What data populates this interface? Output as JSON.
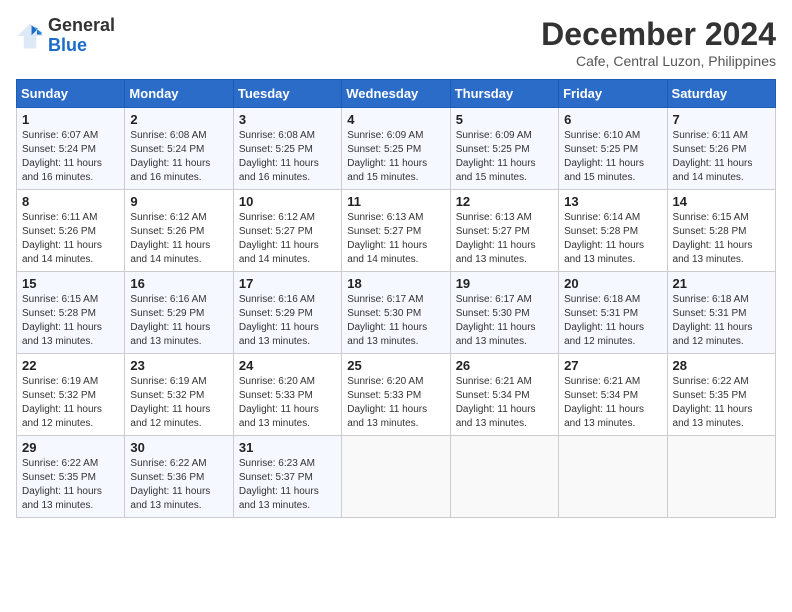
{
  "logo": {
    "general": "General",
    "blue": "Blue"
  },
  "title": "December 2024",
  "location": "Cafe, Central Luzon, Philippines",
  "days_header": [
    "Sunday",
    "Monday",
    "Tuesday",
    "Wednesday",
    "Thursday",
    "Friday",
    "Saturday"
  ],
  "weeks": [
    [
      {
        "day": "1",
        "sunrise": "Sunrise: 6:07 AM",
        "sunset": "Sunset: 5:24 PM",
        "daylight": "Daylight: 11 hours and 16 minutes."
      },
      {
        "day": "2",
        "sunrise": "Sunrise: 6:08 AM",
        "sunset": "Sunset: 5:24 PM",
        "daylight": "Daylight: 11 hours and 16 minutes."
      },
      {
        "day": "3",
        "sunrise": "Sunrise: 6:08 AM",
        "sunset": "Sunset: 5:25 PM",
        "daylight": "Daylight: 11 hours and 16 minutes."
      },
      {
        "day": "4",
        "sunrise": "Sunrise: 6:09 AM",
        "sunset": "Sunset: 5:25 PM",
        "daylight": "Daylight: 11 hours and 15 minutes."
      },
      {
        "day": "5",
        "sunrise": "Sunrise: 6:09 AM",
        "sunset": "Sunset: 5:25 PM",
        "daylight": "Daylight: 11 hours and 15 minutes."
      },
      {
        "day": "6",
        "sunrise": "Sunrise: 6:10 AM",
        "sunset": "Sunset: 5:25 PM",
        "daylight": "Daylight: 11 hours and 15 minutes."
      },
      {
        "day": "7",
        "sunrise": "Sunrise: 6:11 AM",
        "sunset": "Sunset: 5:26 PM",
        "daylight": "Daylight: 11 hours and 14 minutes."
      }
    ],
    [
      {
        "day": "8",
        "sunrise": "Sunrise: 6:11 AM",
        "sunset": "Sunset: 5:26 PM",
        "daylight": "Daylight: 11 hours and 14 minutes."
      },
      {
        "day": "9",
        "sunrise": "Sunrise: 6:12 AM",
        "sunset": "Sunset: 5:26 PM",
        "daylight": "Daylight: 11 hours and 14 minutes."
      },
      {
        "day": "10",
        "sunrise": "Sunrise: 6:12 AM",
        "sunset": "Sunset: 5:27 PM",
        "daylight": "Daylight: 11 hours and 14 minutes."
      },
      {
        "day": "11",
        "sunrise": "Sunrise: 6:13 AM",
        "sunset": "Sunset: 5:27 PM",
        "daylight": "Daylight: 11 hours and 14 minutes."
      },
      {
        "day": "12",
        "sunrise": "Sunrise: 6:13 AM",
        "sunset": "Sunset: 5:27 PM",
        "daylight": "Daylight: 11 hours and 13 minutes."
      },
      {
        "day": "13",
        "sunrise": "Sunrise: 6:14 AM",
        "sunset": "Sunset: 5:28 PM",
        "daylight": "Daylight: 11 hours and 13 minutes."
      },
      {
        "day": "14",
        "sunrise": "Sunrise: 6:15 AM",
        "sunset": "Sunset: 5:28 PM",
        "daylight": "Daylight: 11 hours and 13 minutes."
      }
    ],
    [
      {
        "day": "15",
        "sunrise": "Sunrise: 6:15 AM",
        "sunset": "Sunset: 5:28 PM",
        "daylight": "Daylight: 11 hours and 13 minutes."
      },
      {
        "day": "16",
        "sunrise": "Sunrise: 6:16 AM",
        "sunset": "Sunset: 5:29 PM",
        "daylight": "Daylight: 11 hours and 13 minutes."
      },
      {
        "day": "17",
        "sunrise": "Sunrise: 6:16 AM",
        "sunset": "Sunset: 5:29 PM",
        "daylight": "Daylight: 11 hours and 13 minutes."
      },
      {
        "day": "18",
        "sunrise": "Sunrise: 6:17 AM",
        "sunset": "Sunset: 5:30 PM",
        "daylight": "Daylight: 11 hours and 13 minutes."
      },
      {
        "day": "19",
        "sunrise": "Sunrise: 6:17 AM",
        "sunset": "Sunset: 5:30 PM",
        "daylight": "Daylight: 11 hours and 13 minutes."
      },
      {
        "day": "20",
        "sunrise": "Sunrise: 6:18 AM",
        "sunset": "Sunset: 5:31 PM",
        "daylight": "Daylight: 11 hours and 12 minutes."
      },
      {
        "day": "21",
        "sunrise": "Sunrise: 6:18 AM",
        "sunset": "Sunset: 5:31 PM",
        "daylight": "Daylight: 11 hours and 12 minutes."
      }
    ],
    [
      {
        "day": "22",
        "sunrise": "Sunrise: 6:19 AM",
        "sunset": "Sunset: 5:32 PM",
        "daylight": "Daylight: 11 hours and 12 minutes."
      },
      {
        "day": "23",
        "sunrise": "Sunrise: 6:19 AM",
        "sunset": "Sunset: 5:32 PM",
        "daylight": "Daylight: 11 hours and 12 minutes."
      },
      {
        "day": "24",
        "sunrise": "Sunrise: 6:20 AM",
        "sunset": "Sunset: 5:33 PM",
        "daylight": "Daylight: 11 hours and 13 minutes."
      },
      {
        "day": "25",
        "sunrise": "Sunrise: 6:20 AM",
        "sunset": "Sunset: 5:33 PM",
        "daylight": "Daylight: 11 hours and 13 minutes."
      },
      {
        "day": "26",
        "sunrise": "Sunrise: 6:21 AM",
        "sunset": "Sunset: 5:34 PM",
        "daylight": "Daylight: 11 hours and 13 minutes."
      },
      {
        "day": "27",
        "sunrise": "Sunrise: 6:21 AM",
        "sunset": "Sunset: 5:34 PM",
        "daylight": "Daylight: 11 hours and 13 minutes."
      },
      {
        "day": "28",
        "sunrise": "Sunrise: 6:22 AM",
        "sunset": "Sunset: 5:35 PM",
        "daylight": "Daylight: 11 hours and 13 minutes."
      }
    ],
    [
      {
        "day": "29",
        "sunrise": "Sunrise: 6:22 AM",
        "sunset": "Sunset: 5:35 PM",
        "daylight": "Daylight: 11 hours and 13 minutes."
      },
      {
        "day": "30",
        "sunrise": "Sunrise: 6:22 AM",
        "sunset": "Sunset: 5:36 PM",
        "daylight": "Daylight: 11 hours and 13 minutes."
      },
      {
        "day": "31",
        "sunrise": "Sunrise: 6:23 AM",
        "sunset": "Sunset: 5:37 PM",
        "daylight": "Daylight: 11 hours and 13 minutes."
      },
      null,
      null,
      null,
      null
    ]
  ]
}
